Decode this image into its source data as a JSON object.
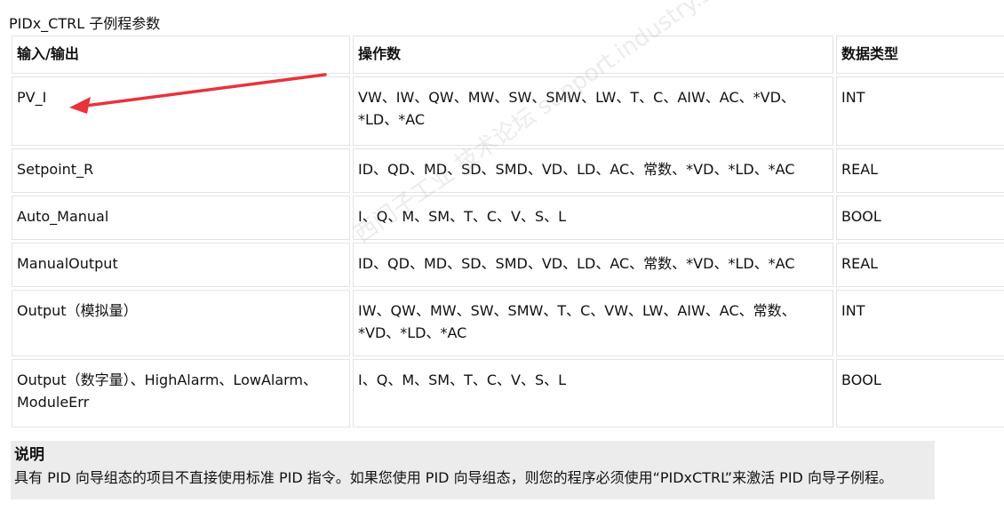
{
  "caption": "PIDx_CTRL 子例程参数",
  "table": {
    "headers": [
      "输入/输出",
      "操作数",
      "数据类型"
    ],
    "rows": [
      [
        "PV_I",
        "VW、IW、QW、MW、SW、SMW、LW、T、C、AIW、AC、*VD、*LD、*AC",
        "INT"
      ],
      [
        "Setpoint_R",
        "ID、QD、MD、SD、SMD、VD、LD、AC、常数、*VD、*LD、*AC",
        "REAL"
      ],
      [
        "Auto_Manual",
        "I、Q、M、SM、T、C、V、S、L",
        "BOOL"
      ],
      [
        "ManualOutput",
        "ID、QD、MD、SD、SMD、VD、LD、AC、常数、*VD、*LD、*AC",
        "REAL"
      ],
      [
        "Output（模拟量）",
        "IW、QW、MW、SW、SMW、T、C、VW、LW、AIW、AC、常数、*VD、*LD、*AC",
        "INT"
      ],
      [
        "Output（数字量）、HighAlarm、LowAlarm、ModuleErr",
        "I、Q、M、SM、T、C、V、S、L",
        "BOOL"
      ]
    ]
  },
  "note": {
    "title": "说明",
    "body": "具有 PID 向导组态的项目不直接使用标准 PID 指令。如果您使用 PID 向导组态，则您的程序必须使用“PIDxCTRL”来激活 PID 向导子例程。"
  },
  "annotation": {
    "arrow_color": "#e8333a"
  },
  "watermark": "西门子工业 技术论坛 support.industry.siemens.com/cs"
}
